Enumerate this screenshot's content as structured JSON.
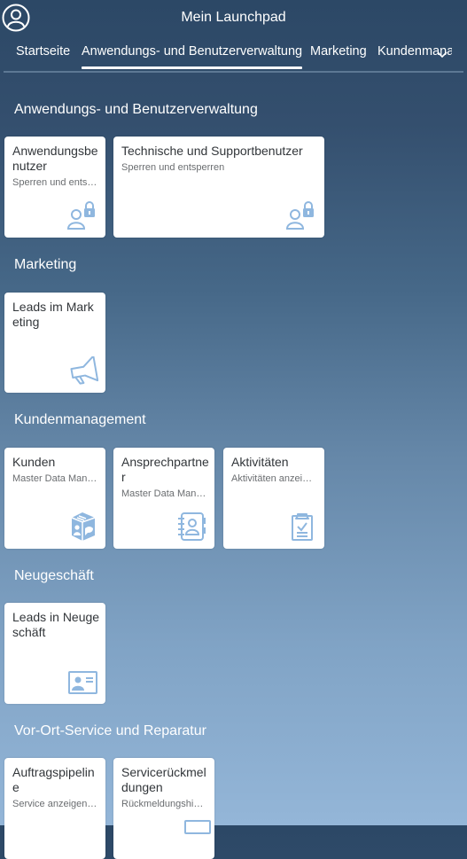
{
  "shell": {
    "title": "Mein Launchpad",
    "avatar_icon": "user-avatar-icon"
  },
  "tabs": [
    {
      "label": "Startseite",
      "active": false
    },
    {
      "label": "Anwendungs- und Benutzerverwaltung",
      "active": true
    },
    {
      "label": "Marketing",
      "active": false
    },
    {
      "label": "Kundenmanagement",
      "active": false
    }
  ],
  "overflow_icon": "chevron-down-icon",
  "sections": [
    {
      "title": "Anwendungs- und Benutzerverwaltung",
      "tiles": [
        {
          "title": "Anwendungsbenutzer",
          "subtitle": "Sperren und entsperren",
          "icon": "user-locked-icon"
        },
        {
          "title": "Technische und Supportbenutzer",
          "subtitle": "Sperren und entsperren",
          "icon": "user-locked-icon"
        }
      ]
    },
    {
      "title": "Marketing",
      "tiles": [
        {
          "title": "Leads im Marketing",
          "subtitle": "",
          "icon": "megaphone-icon"
        }
      ]
    },
    {
      "title": "Kundenmanagement",
      "tiles": [
        {
          "title": "Kunden",
          "subtitle": "Master Data Management",
          "icon": "customer-icon"
        },
        {
          "title": "Ansprechpartner",
          "subtitle": "Master Data Management",
          "icon": "address-book-icon"
        },
        {
          "title": "Aktivitäten",
          "subtitle": "Aktivitäten anzeigen",
          "icon": "clipboard-check-icon"
        }
      ]
    },
    {
      "title": "Neugeschäft",
      "tiles": [
        {
          "title": "Leads in Neugeschäft",
          "subtitle": "",
          "icon": "business-card-icon"
        }
      ]
    },
    {
      "title": "Vor-Ort-Service und Reparatur",
      "tiles": [
        {
          "title": "Auftragspipeline",
          "subtitle": "Service anzeigen, bearbeiten",
          "icon": ""
        },
        {
          "title": "Servicerückmeldungen",
          "subtitle": "Rückmeldungshistorie",
          "icon": ""
        }
      ]
    }
  ],
  "colors": {
    "icon": "#8fb7df",
    "tile_title": "#32363a",
    "tile_subtitle": "#6a6d70",
    "shell_bg": "#2c4866"
  }
}
